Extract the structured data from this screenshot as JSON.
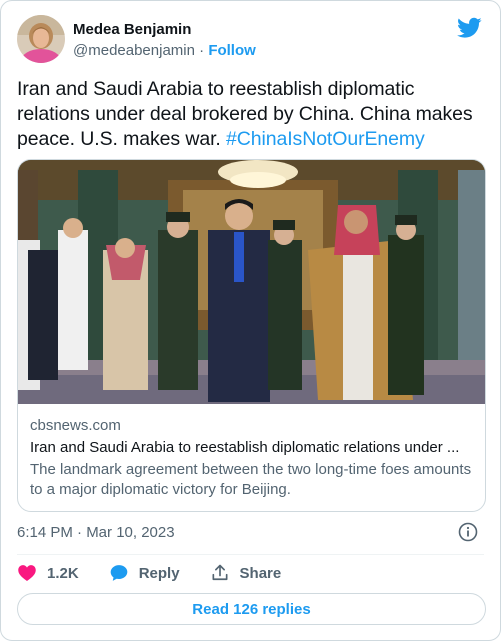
{
  "author": {
    "name": "Medea Benjamin",
    "handle": "@medeabenjamin",
    "separator": "·",
    "follow_label": "Follow"
  },
  "tweet": {
    "text": "Iran and Saudi Arabia to reestablish diplomatic relations under deal brokered by China. China makes peace. U.S. makes war. ",
    "hashtag": "#ChinaIsNotOurEnemy"
  },
  "link_card": {
    "domain": "cbsnews.com",
    "title": "Iran and Saudi Arabia to reestablish diplomatic relations under ...",
    "description": "The landmark agreement between the two long-time foes amounts to a major diplomatic victory for Beijing."
  },
  "timestamp": "6:14 PM · Mar 10, 2023",
  "actions": {
    "like_count": "1.2K",
    "reply_label": "Reply",
    "share_label": "Share"
  },
  "read_replies_label": "Read 126 replies",
  "icons": [
    "twitter-bird-icon",
    "info-icon",
    "heart-icon",
    "reply-bubble-icon",
    "share-icon"
  ],
  "colors": {
    "accent": "#1d9bf0",
    "like": "#f91880",
    "secondary_text": "#536471",
    "border": "#cfd9de"
  }
}
